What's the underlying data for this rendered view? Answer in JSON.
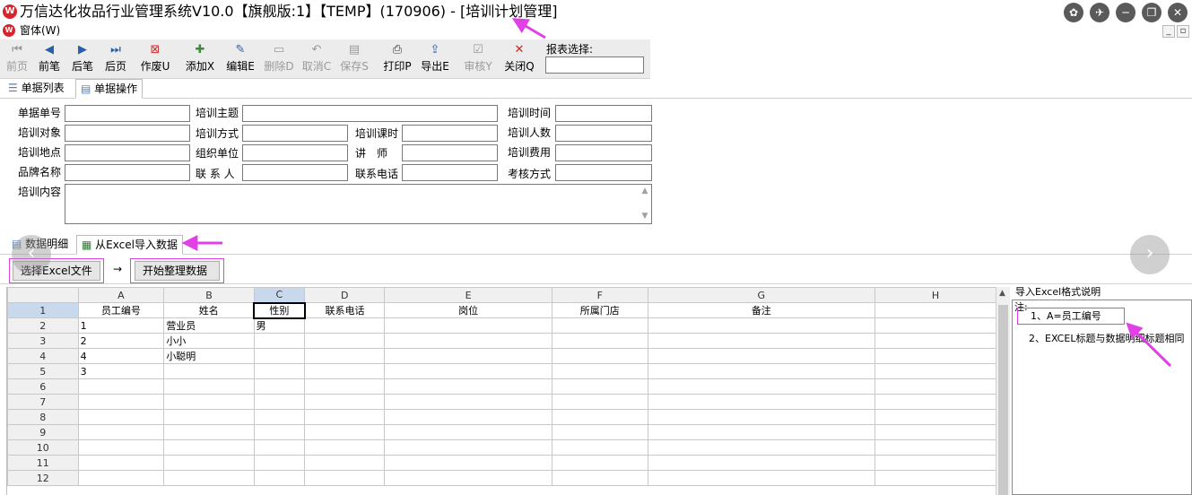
{
  "window": {
    "title": "万信达化妆品行业管理系统V10.0【旗舰版:1】【TEMP】(170906) - [培训计划管理]",
    "menu_window": "窗体(W)",
    "controls": [
      "skin-icon",
      "pin-icon",
      "minimize-icon",
      "restore-icon",
      "close-icon"
    ]
  },
  "toolbar": {
    "buttons": [
      {
        "label": "前页",
        "icon": "first-page-icon",
        "enabled": false
      },
      {
        "label": "前笔",
        "icon": "prev-record-icon",
        "enabled": true
      },
      {
        "label": "后笔",
        "icon": "next-record-icon",
        "enabled": true
      },
      {
        "label": "后页",
        "icon": "last-page-icon",
        "enabled": true
      },
      {
        "label": "作废U",
        "icon": "void-icon",
        "enabled": true
      },
      {
        "label": "添加X",
        "icon": "add-icon",
        "enabled": true
      },
      {
        "label": "编辑E",
        "icon": "edit-icon",
        "enabled": true
      },
      {
        "label": "删除D",
        "icon": "delete-icon",
        "enabled": false
      },
      {
        "label": "取消C",
        "icon": "undo-icon",
        "enabled": false
      },
      {
        "label": "保存S",
        "icon": "save-icon",
        "enabled": false
      },
      {
        "label": "打印P",
        "icon": "print-icon",
        "enabled": true
      },
      {
        "label": "导出E",
        "icon": "export-icon",
        "enabled": true
      },
      {
        "label": "审核Y",
        "icon": "approve-icon",
        "enabled": false
      },
      {
        "label": "关闭Q",
        "icon": "close-icon",
        "enabled": true
      }
    ],
    "report_select_label": "报表选择:",
    "report_select_value": ""
  },
  "top_tabs": [
    {
      "label": "单据列表",
      "icon": "list-icon",
      "active": false
    },
    {
      "label": "单据操作",
      "icon": "form-icon",
      "active": true
    }
  ],
  "form": {
    "doc_no_label": "单据单号",
    "topic_label": "培训主题",
    "time_label": "培训时间",
    "target_label": "培训对象",
    "method_label": "培训方式",
    "hours_label": "培训课时",
    "people_label": "培训人数",
    "location_label": "培训地点",
    "organizer_label": "组织单位",
    "lecturer_label": "讲　师",
    "cost_label": "培训费用",
    "brand_label": "品牌名称",
    "contact_label": "联 系 人",
    "phone_label": "联系电话",
    "assess_label": "考核方式",
    "content_label": "培训内容"
  },
  "bottom_tabs": [
    {
      "label": "数据明细",
      "icon": "detail-icon",
      "active": false
    },
    {
      "label": "从Excel导入数据",
      "icon": "excel-icon",
      "active": true
    }
  ],
  "excel_toolbar": {
    "choose_file": "选择Excel文件",
    "arrow": "→",
    "start": "开始整理数据"
  },
  "sheet": {
    "columns": [
      "A",
      "B",
      "C",
      "D",
      "E",
      "F",
      "G",
      "H"
    ],
    "row_numbers": [
      "1",
      "2",
      "3",
      "4",
      "5",
      "6",
      "7",
      "8",
      "9",
      "10",
      "11",
      "12"
    ],
    "header_row": [
      "员工编号",
      "姓名",
      "性别",
      "联系电话",
      "岗位",
      "所属门店",
      "备注",
      ""
    ],
    "rows": [
      [
        "1",
        "营业员",
        "男",
        "",
        "",
        "",
        "",
        ""
      ],
      [
        "2",
        "小小",
        "",
        "",
        "",
        "",
        "",
        ""
      ],
      [
        "4",
        "小聪明",
        "",
        "",
        "",
        "",
        "",
        ""
      ],
      [
        "3",
        "",
        "",
        "",
        "",
        "",
        "",
        ""
      ],
      [
        "",
        "",
        "",
        "",
        "",
        "",
        "",
        ""
      ],
      [
        "",
        "",
        "",
        "",
        "",
        "",
        "",
        ""
      ],
      [
        "",
        "",
        "",
        "",
        "",
        "",
        "",
        ""
      ],
      [
        "",
        "",
        "",
        "",
        "",
        "",
        "",
        ""
      ],
      [
        "",
        "",
        "",
        "",
        "",
        "",
        "",
        ""
      ],
      [
        "",
        "",
        "",
        "",
        "",
        "",
        "",
        ""
      ],
      [
        "",
        "",
        "",
        "",
        "",
        "",
        "",
        ""
      ]
    ],
    "selected_column": "C"
  },
  "right_panel": {
    "title": "导入Excel格式说明",
    "note_heading": "注:",
    "line1": "1、A=员工编号",
    "line2": "2、EXCEL标题与数据明细标题相同"
  },
  "colors": {
    "annotation": "#e040e6",
    "toolbar_bg": "#ececec",
    "selected_header": "#c8d9ee"
  }
}
